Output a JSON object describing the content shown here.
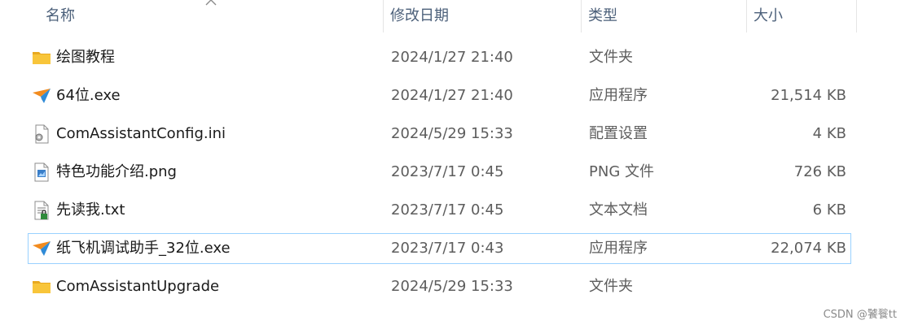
{
  "columns": {
    "name": "名称",
    "date": "修改日期",
    "type": "类型",
    "size": "大小"
  },
  "files": [
    {
      "name": "绘图教程",
      "date": "2024/1/27 21:40",
      "type": "文件夹",
      "size": "",
      "icon": "folder-icon"
    },
    {
      "name": "64位.exe",
      "date": "2024/1/27 21:40",
      "type": "应用程序",
      "size": "21,514 KB",
      "icon": "paper-plane-app-icon"
    },
    {
      "name": "ComAssistantConfig.ini",
      "date": "2024/5/29 15:33",
      "type": "配置设置",
      "size": "4 KB",
      "icon": "settings-file-icon"
    },
    {
      "name": "特色功能介绍.png",
      "date": "2023/7/17 0:45",
      "type": "PNG 文件",
      "size": "726 KB",
      "icon": "image-file-icon"
    },
    {
      "name": "先读我.txt",
      "date": "2023/7/17 0:45",
      "type": "文本文档",
      "size": "6 KB",
      "icon": "text-file-icon"
    },
    {
      "name": "纸飞机调试助手_32位.exe",
      "date": "2023/7/17 0:43",
      "type": "应用程序",
      "size": "22,074 KB",
      "icon": "paper-plane-app-icon"
    },
    {
      "name": "ComAssistantUpgrade",
      "date": "2024/5/29 15:33",
      "type": "文件夹",
      "size": "",
      "icon": "folder-icon"
    }
  ],
  "watermark": "CSDN @饕餮tt",
  "colors": {
    "header_text": "#4c607a",
    "selection_border": "#99d1ff",
    "folder": "#f8c53a",
    "plane_orange": "#f28b1e",
    "plane_blue": "#2e8bd8"
  }
}
